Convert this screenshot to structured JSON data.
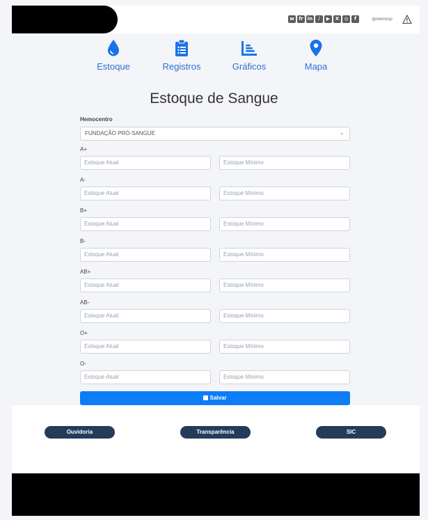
{
  "header": {
    "social_icons": [
      "whatsapp-icon",
      "flickr-icon",
      "linkedin-icon",
      "tiktok-icon",
      "youtube-icon",
      "x-icon",
      "instagram-icon",
      "facebook-icon"
    ],
    "handle": "/governosp"
  },
  "nav": [
    {
      "label": "Estoque",
      "icon": "blood-drop-icon"
    },
    {
      "label": "Registros",
      "icon": "clipboard-list-icon"
    },
    {
      "label": "Gráficos",
      "icon": "chart-icon"
    },
    {
      "label": "Mapa",
      "icon": "map-pin-icon"
    }
  ],
  "page_title": "Estoque de Sangue",
  "form": {
    "hemocentro_label": "Hemocentro",
    "hemocentro_value": "FUNDAÇÃO PRÓ-SANGUE",
    "placeholder_atual": "Estoque Atual",
    "placeholder_minimo": "Estoque Mínimo",
    "blood_types": [
      "A+",
      "A-",
      "B+",
      "B-",
      "AB+",
      "AB-",
      "O+",
      "O-"
    ],
    "save_label": "Salvar"
  },
  "footer": {
    "buttons": [
      "Ouvidoria",
      "Transparência",
      "SIC"
    ]
  },
  "colors": {
    "accent": "#0d7df7",
    "nav": "#2c6fd6",
    "footer_button": "#243c5a"
  }
}
